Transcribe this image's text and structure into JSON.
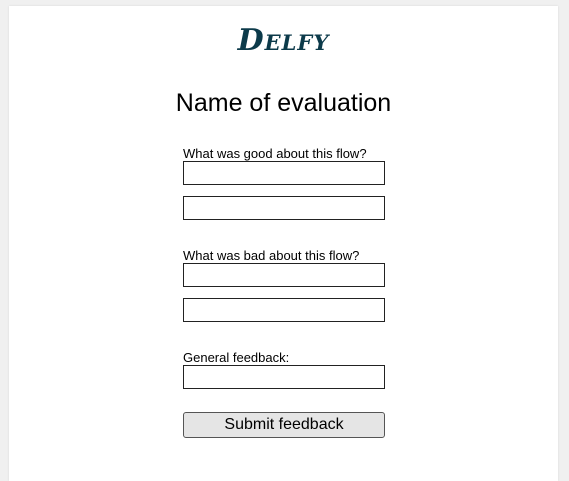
{
  "app": {
    "logo_text": "Delfy",
    "brand_color": "#0c3a4a"
  },
  "page": {
    "title": "Name of evaluation"
  },
  "form": {
    "good_label": "What was good about this flow?",
    "good_values": [
      "",
      ""
    ],
    "bad_label": "What was bad about this flow?",
    "bad_values": [
      "",
      ""
    ],
    "general_label": "General feedback:",
    "general_value": "",
    "submit_label": "Submit feedback"
  }
}
